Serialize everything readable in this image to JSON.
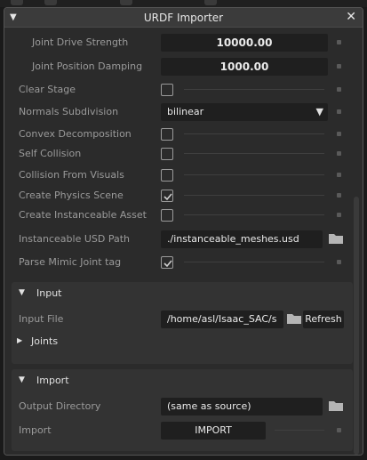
{
  "window": {
    "title": "URDF Importer"
  },
  "settings": {
    "joint_drive_strength": {
      "label": "Joint Drive Strength",
      "value": "10000.00"
    },
    "joint_position_damping": {
      "label": "Joint Position Damping",
      "value": "1000.00"
    },
    "clear_stage": {
      "label": "Clear Stage",
      "checked": false
    },
    "normals_subdivision": {
      "label": "Normals Subdivision",
      "value": "bilinear"
    },
    "convex_decomposition": {
      "label": "Convex Decomposition",
      "checked": false
    },
    "self_collision": {
      "label": "Self Collision",
      "checked": false
    },
    "collision_from_visuals": {
      "label": "Collision From Visuals",
      "checked": false
    },
    "create_physics_scene": {
      "label": "Create Physics Scene",
      "checked": true
    },
    "create_instanceable_asset": {
      "label": "Create Instanceable Asset",
      "checked": false
    },
    "instanceable_usd_path": {
      "label": "Instanceable USD Path",
      "value": "./instanceable_meshes.usd"
    },
    "parse_mimic_joint_tag": {
      "label": "Parse Mimic Joint tag",
      "checked": true
    }
  },
  "input_section": {
    "title": "Input",
    "input_file": {
      "label": "Input File",
      "value": "/home/asl/Isaac_SAC/s"
    },
    "refresh_label": "Refresh",
    "joints_label": "Joints"
  },
  "import_section": {
    "title": "Import",
    "output_directory": {
      "label": "Output Directory",
      "value": "(same as source)"
    },
    "import_label": "Import",
    "import_button": "IMPORT"
  },
  "colors": {
    "background": "#2b2b2b",
    "field": "#1f1f1f",
    "section": "#333333",
    "label": "#9a9a9a"
  }
}
